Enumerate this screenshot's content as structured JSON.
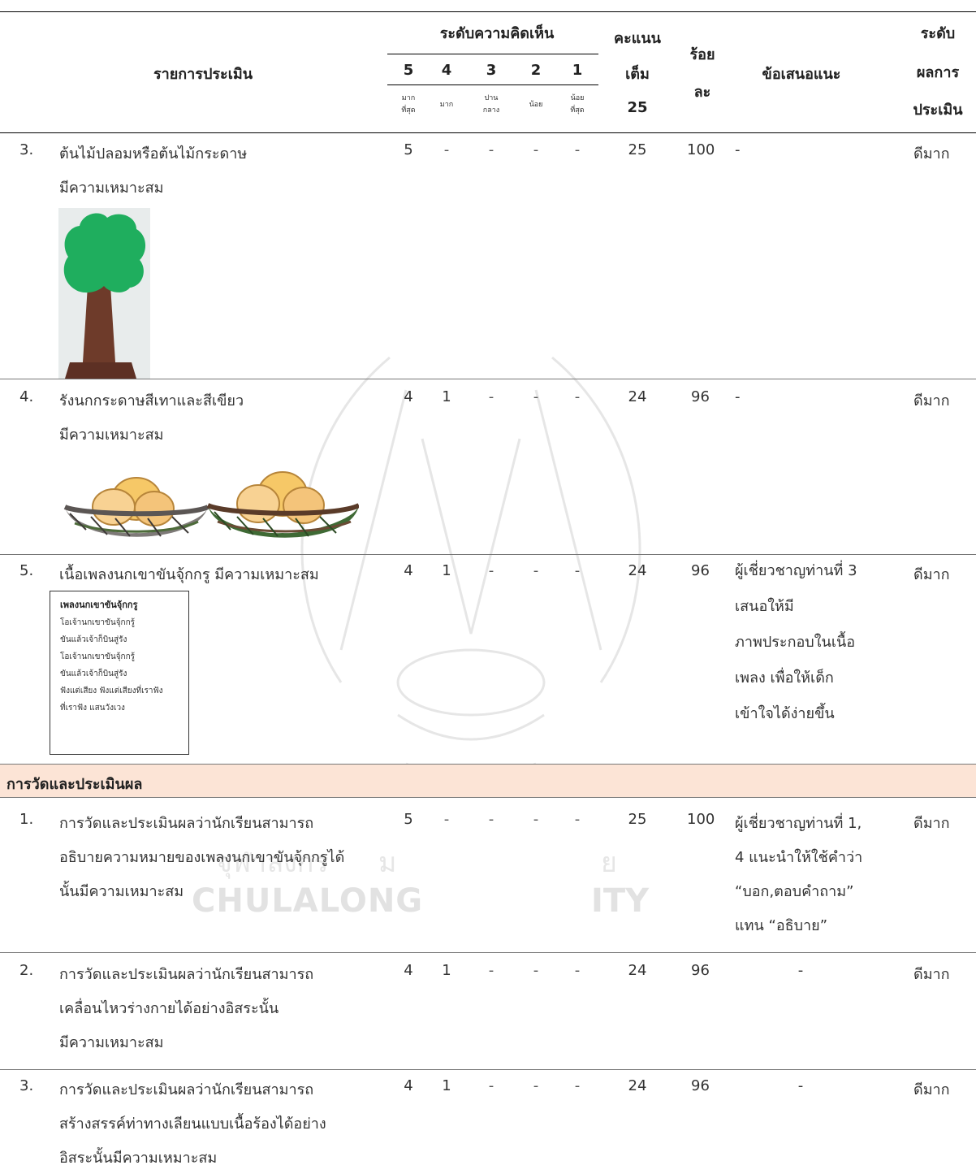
{
  "header": {
    "item_col": "รายการประเมิน",
    "opinion_group": "ระดับความคิดเห็น",
    "scales": [
      {
        "num": "5",
        "label": "มาก\nที่สุด"
      },
      {
        "num": "4",
        "label": "มาก"
      },
      {
        "num": "3",
        "label": "ปาน\nกลาง"
      },
      {
        "num": "2",
        "label": "น้อย"
      },
      {
        "num": "1",
        "label": "น้อย\nที่สุด"
      }
    ],
    "score_line1": "คะแนน",
    "score_line2": "เต็ม",
    "score_line3": "25",
    "percent_line1": "ร้อย",
    "percent_line2": "ละ",
    "suggestion": "ข้อเสนอแนะ",
    "result_line1": "ระดับ",
    "result_line2": "ผลการ",
    "result_line3": "ประเมิน"
  },
  "rows": [
    {
      "no": "3.",
      "lines": [
        "ต้นไม้ปลอมหรือต้นไม้กระดาษ",
        "มีความเหมาะสม"
      ],
      "c5": "5",
      "c4": "-",
      "c3": "-",
      "c2": "-",
      "c1": "-",
      "score": "25",
      "percent": "100",
      "suggestion": [
        "-"
      ],
      "result": "ดีมาก",
      "image": "paper-tree"
    },
    {
      "no": "4.",
      "lines": [
        "รังนกกระดาษสีเทาและสีเขียว",
        "มีความเหมาะสม"
      ],
      "c5": "4",
      "c4": "1",
      "c3": "-",
      "c2": "-",
      "c1": "-",
      "score": "24",
      "percent": "96",
      "suggestion": [
        "-"
      ],
      "result": "ดีมาก",
      "image": "paper-nests"
    },
    {
      "no": "5.",
      "lines": [
        "เนื้อเพลงนกเขาขันจุ้กกรู มีความเหมาะสม"
      ],
      "c5": "4",
      "c4": "1",
      "c3": "-",
      "c2": "-",
      "c1": "-",
      "score": "24",
      "percent": "96",
      "suggestion": [
        "ผู้เชี่ยวชาญท่านที่ 3",
        "เสนอให้มี",
        "ภาพประกอบในเนื้อ",
        "เพลง เพื่อให้เด็ก",
        "เข้าใจได้ง่ายขึ้น"
      ],
      "result": "ดีมาก",
      "lyrics": {
        "title": "เพลงนกเขาขันจุ้กกรู",
        "lines": [
          "โอเจ้านกเขาขันจุ้กกรู้",
          "ขันแล้วเจ้าก็บินสู่รัง",
          "โอเจ้านกเขาขันจุ้กกรู้",
          "ขันแล้วเจ้าก็บินสู่รัง",
          "ฟังแต่เสียง ฟังแต่เสียงที่เราฟัง",
          "ที่เราฟัง แสนวังเวง"
        ]
      }
    }
  ],
  "section": {
    "title": "การวัดและประเมินผล",
    "band_color": "#fce4d6"
  },
  "rows2": [
    {
      "no": "1.",
      "lines": [
        "การวัดและประเมินผลว่านักเรียนสามารถ",
        "อธิบายความหมายของเพลงนกเขาขันจุ้กกรูได้",
        "นั้นมีความเหมาะสม"
      ],
      "c5": "5",
      "c4": "-",
      "c3": "-",
      "c2": "-",
      "c1": "-",
      "score": "25",
      "percent": "100",
      "suggestion": [
        "ผู้เชี่ยวชาญท่านที่ 1,",
        "4 แนะนำให้ใช้คำว่า",
        "“บอก,ตอบคำถาม”",
        "แทน “อธิบาย”"
      ],
      "result": "ดีมาก"
    },
    {
      "no": "2.",
      "lines": [
        "การวัดและประเมินผลว่านักเรียนสามารถ",
        "เคลื่อนไหวร่างกายได้อย่างอิสระนั้น",
        "มีความเหมาะสม"
      ],
      "c5": "4",
      "c4": "1",
      "c3": "-",
      "c2": "-",
      "c1": "-",
      "score": "24",
      "percent": "96",
      "suggestion": [
        "-"
      ],
      "result": "ดีมาก"
    },
    {
      "no": "3.",
      "lines": [
        "การวัดและประเมินผลว่านักเรียนสามารถ",
        "สร้างสรรค์ท่าทางเลียนแบบเนื้อร้องได้อย่าง",
        "อิสระนั้นมีความเหมาะสม"
      ],
      "c5": "4",
      "c4": "1",
      "c3": "-",
      "c2": "-",
      "c1": "-",
      "score": "24",
      "percent": "96",
      "suggestion": [
        "-"
      ],
      "result": "ดีมาก"
    }
  ],
  "watermark": {
    "text_left": "CHULALONG",
    "text_right": "ITY",
    "text_mid": "จุฬาลงกร",
    "text_mid2": "ม",
    "text_mid3": "ย"
  }
}
